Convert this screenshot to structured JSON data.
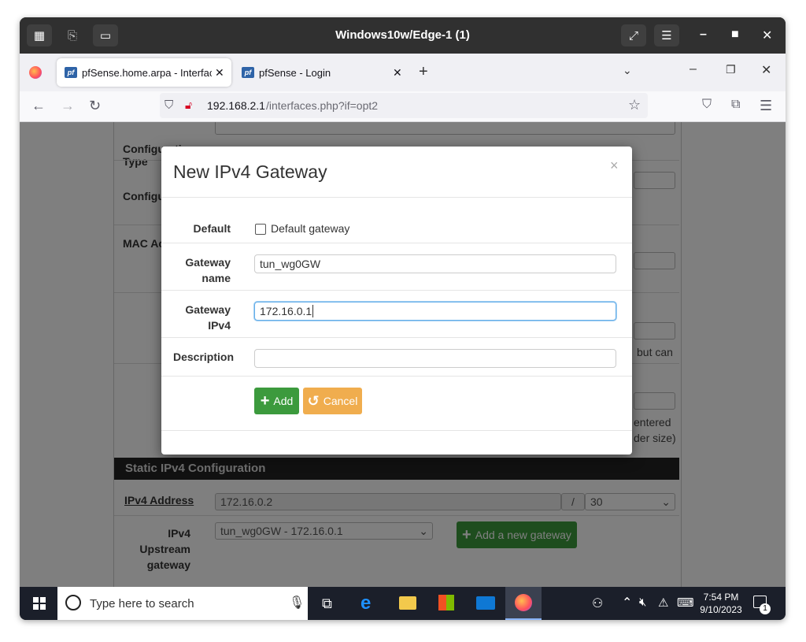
{
  "window": {
    "title": "Windows10w/Edge-1 (1)"
  },
  "browser": {
    "tabs": [
      {
        "label": "pfSense.home.arpa - Interfaces",
        "active": true
      },
      {
        "label": "pfSense - Login",
        "active": false
      }
    ],
    "url": {
      "host": "192.168.2.1",
      "path": "/interfaces.php?if=opt2"
    }
  },
  "page": {
    "rows": {
      "configuration_type": "Configuration Type",
      "configuration_type_2": "Configu",
      "mac_address": "MAC Ac",
      "hint_text_1": "but can",
      "hint_text_2": "entered",
      "hint_text_3": "der size)"
    },
    "static_section": {
      "header": "Static IPv4 Configuration",
      "ipv4_address_label": "IPv4 Address",
      "ipv4_address_value": "172.16.0.2",
      "slash": "/",
      "cidr_value": "30",
      "upstream_label_1": "IPv4",
      "upstream_label_2": "Upstream",
      "upstream_label_3": "gateway",
      "upstream_value": "tun_wg0GW - 172.16.0.1",
      "add_gateway_label": "Add a new gateway"
    }
  },
  "modal": {
    "title": "New IPv4 Gateway",
    "close_glyph": "×",
    "default_label": "Default",
    "default_checkbox_label": "Default gateway",
    "default_checked": false,
    "gateway_name_label_1": "Gateway",
    "gateway_name_label_2": "name",
    "gateway_name_value": "tun_wg0GW",
    "gateway_ipv4_label_1": "Gateway",
    "gateway_ipv4_label_2": "IPv4",
    "gateway_ipv4_value": "172.16.0.1",
    "description_label": "Description",
    "description_value": "",
    "add_label": "Add",
    "cancel_label": "Cancel",
    "colors": {
      "add": "#3c9a3d",
      "cancel": "#f0ad4e",
      "focus": "#66afe9"
    }
  },
  "taskbar": {
    "search_placeholder": "Type here to search",
    "time": "7:54 PM",
    "date": "9/10/2023",
    "notification_count": "1"
  }
}
